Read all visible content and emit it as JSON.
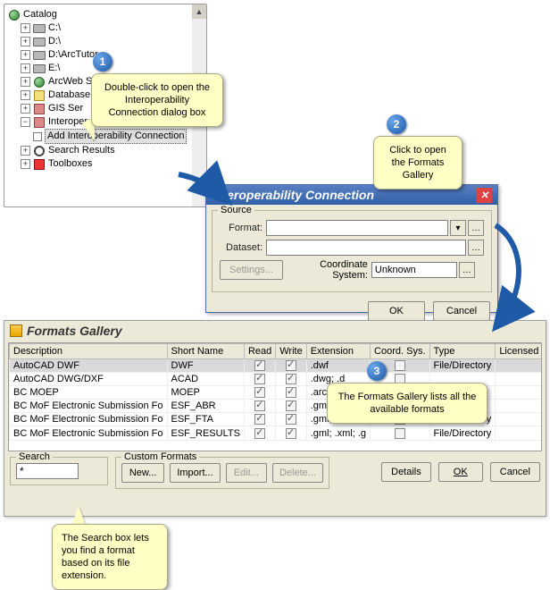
{
  "tree": {
    "root": "Catalog",
    "items": [
      {
        "glyph": "+",
        "icon": "disk-icon",
        "label": "C:\\"
      },
      {
        "glyph": "+",
        "icon": "disk-icon",
        "label": "D:\\"
      },
      {
        "glyph": "+",
        "icon": "disk-icon",
        "label": "D:\\ArcTutor"
      },
      {
        "glyph": "+",
        "icon": "disk-icon",
        "label": "E:\\"
      },
      {
        "glyph": "+",
        "icon": "globe-icon",
        "label": "ArcWeb Servic"
      },
      {
        "glyph": "+",
        "icon": "db-icon",
        "label": "Database Co"
      },
      {
        "glyph": "+",
        "icon": "gear-icon",
        "label": "GIS Ser"
      },
      {
        "glyph": "−",
        "icon": "gear-icon",
        "label": "Interoperability Connections"
      },
      {
        "glyph": "+",
        "icon": "search-tree-icon",
        "label": "Search Results"
      },
      {
        "glyph": "+",
        "icon": "red-icon",
        "label": "Toolboxes"
      }
    ],
    "childLabel": "Add Interoperability Connection"
  },
  "interop": {
    "title": "Interoperability Connection",
    "source": "Source",
    "formatLabel": "Format:",
    "datasetLabel": "Dataset:",
    "coordLabel": "Coordinate System:",
    "coordValue": "Unknown",
    "settings": "Settings...",
    "ok": "OK",
    "cancel": "Cancel"
  },
  "gallery": {
    "title": "Formats Gallery",
    "columns": {
      "desc": "Description",
      "short": "Short Name",
      "read": "Read",
      "write": "Write",
      "ext": "Extension",
      "coord": "Coord. Sys.",
      "type": "Type",
      "lic": "Licensed"
    },
    "searchLabel": "Search",
    "searchValue": "*",
    "customLabel": "Custom Formats",
    "btnNew": "New...",
    "btnImport": "Import...",
    "btnEdit": "Edit...",
    "btnDelete": "Delete...",
    "btnDetails": "Details",
    "btnOk": "OK",
    "btnCancel": "Cancel",
    "rows": [
      {
        "desc": "AutoCAD DWF",
        "short": "DWF",
        "read": true,
        "write": true,
        "ext": ".dwf",
        "coord": "",
        "type": "File/Directory"
      },
      {
        "desc": "AutoCAD DWG/DXF",
        "short": "ACAD",
        "read": true,
        "write": true,
        "ext": ".dwg; .d",
        "coord": "",
        "type": ""
      },
      {
        "desc": "BC MOEP",
        "short": "MOEP",
        "read": true,
        "write": true,
        "ext": ".arc; .bin; .",
        "coord": "",
        "type": ""
      },
      {
        "desc": "BC MoF Electronic Submission Fo",
        "short": "ESF_ABR",
        "read": true,
        "write": true,
        "ext": ".gml; .xml;",
        "coord": "",
        "type": ""
      },
      {
        "desc": "BC MoF Electronic Submission Fo",
        "short": "ESF_FTA",
        "read": true,
        "write": true,
        "ext": ".gml; .xml;",
        "coord": "",
        "type": "File/Directory"
      },
      {
        "desc": "BC MoF Electronic Submission Fo",
        "short": "ESF_RESULTS",
        "read": true,
        "write": true,
        "ext": ".gml; .xml; .g",
        "coord": "",
        "type": "File/Directory"
      }
    ]
  },
  "callouts": {
    "c1": "Double-click to open the Interoperability Connection dialog box",
    "c2": "Click to open the Formats Gallery",
    "c3": "The Formats Gallery lists all the available formats",
    "c4": "The Search box lets you find a format based on its file extension."
  },
  "steps": {
    "s1": "1",
    "s2": "2",
    "s3": "3"
  }
}
